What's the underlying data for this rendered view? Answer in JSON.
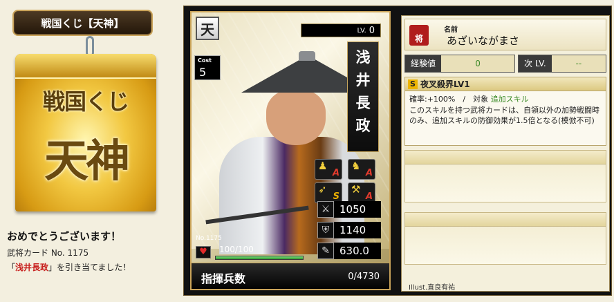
{
  "left": {
    "title": "戦国くじ【天神】",
    "ticket": {
      "line1": "戦国くじ",
      "line2": "天神"
    },
    "message": {
      "title": "おめでとうございます！",
      "card_number_line": "武将カード No. 1175",
      "result_prefix": "「",
      "result_name": "浅井長政",
      "result_suffix": "」を引き当てました！"
    }
  },
  "card": {
    "rarity_badge": "天",
    "level_label": "LV.",
    "level_value": "0",
    "cost_label": "Cost",
    "cost_value": "5",
    "name_chars": [
      "浅",
      "井",
      "長",
      "政"
    ],
    "aptitudes": [
      {
        "icon": "spear-icon",
        "grade": "A"
      },
      {
        "icon": "horse-icon",
        "grade": "A"
      },
      {
        "icon": "bow-icon",
        "grade": "S"
      },
      {
        "icon": "siege-icon",
        "grade": "A"
      }
    ],
    "stats": [
      {
        "icon": "attack-icon",
        "value": "1050"
      },
      {
        "icon": "defense-icon",
        "value": "1140"
      },
      {
        "icon": "strategy-icon",
        "value": "630.0"
      }
    ],
    "number_label": "No.1175",
    "hp_text": "100/100",
    "hp_fraction": 1.0,
    "troops_label": "指揮兵数",
    "troops_value": "0/4730"
  },
  "info": {
    "seal_text": "将",
    "name_label": "名前",
    "name_kana": "あざいながまさ",
    "exp_label": "経験値",
    "exp_value": "0",
    "next_label": "次 LV.",
    "next_value": "--",
    "skill": {
      "rank": "S",
      "name": "夜叉殺界LV1",
      "meta_prefix": "確率:+100%　/　対象",
      "meta_add": "追加スキル",
      "description": "このスキルを持つ武将カードは、自領以外の加勢戦闘時のみ、追加スキルの防御効果が1.5倍となる(模倣不可)"
    },
    "illust": "Illust.直良有祐"
  },
  "colors": {
    "background": "#f3efdf",
    "accent_gold": "#caa45a",
    "highlight_red": "#c8211f",
    "value_green": "#3c8a28"
  }
}
